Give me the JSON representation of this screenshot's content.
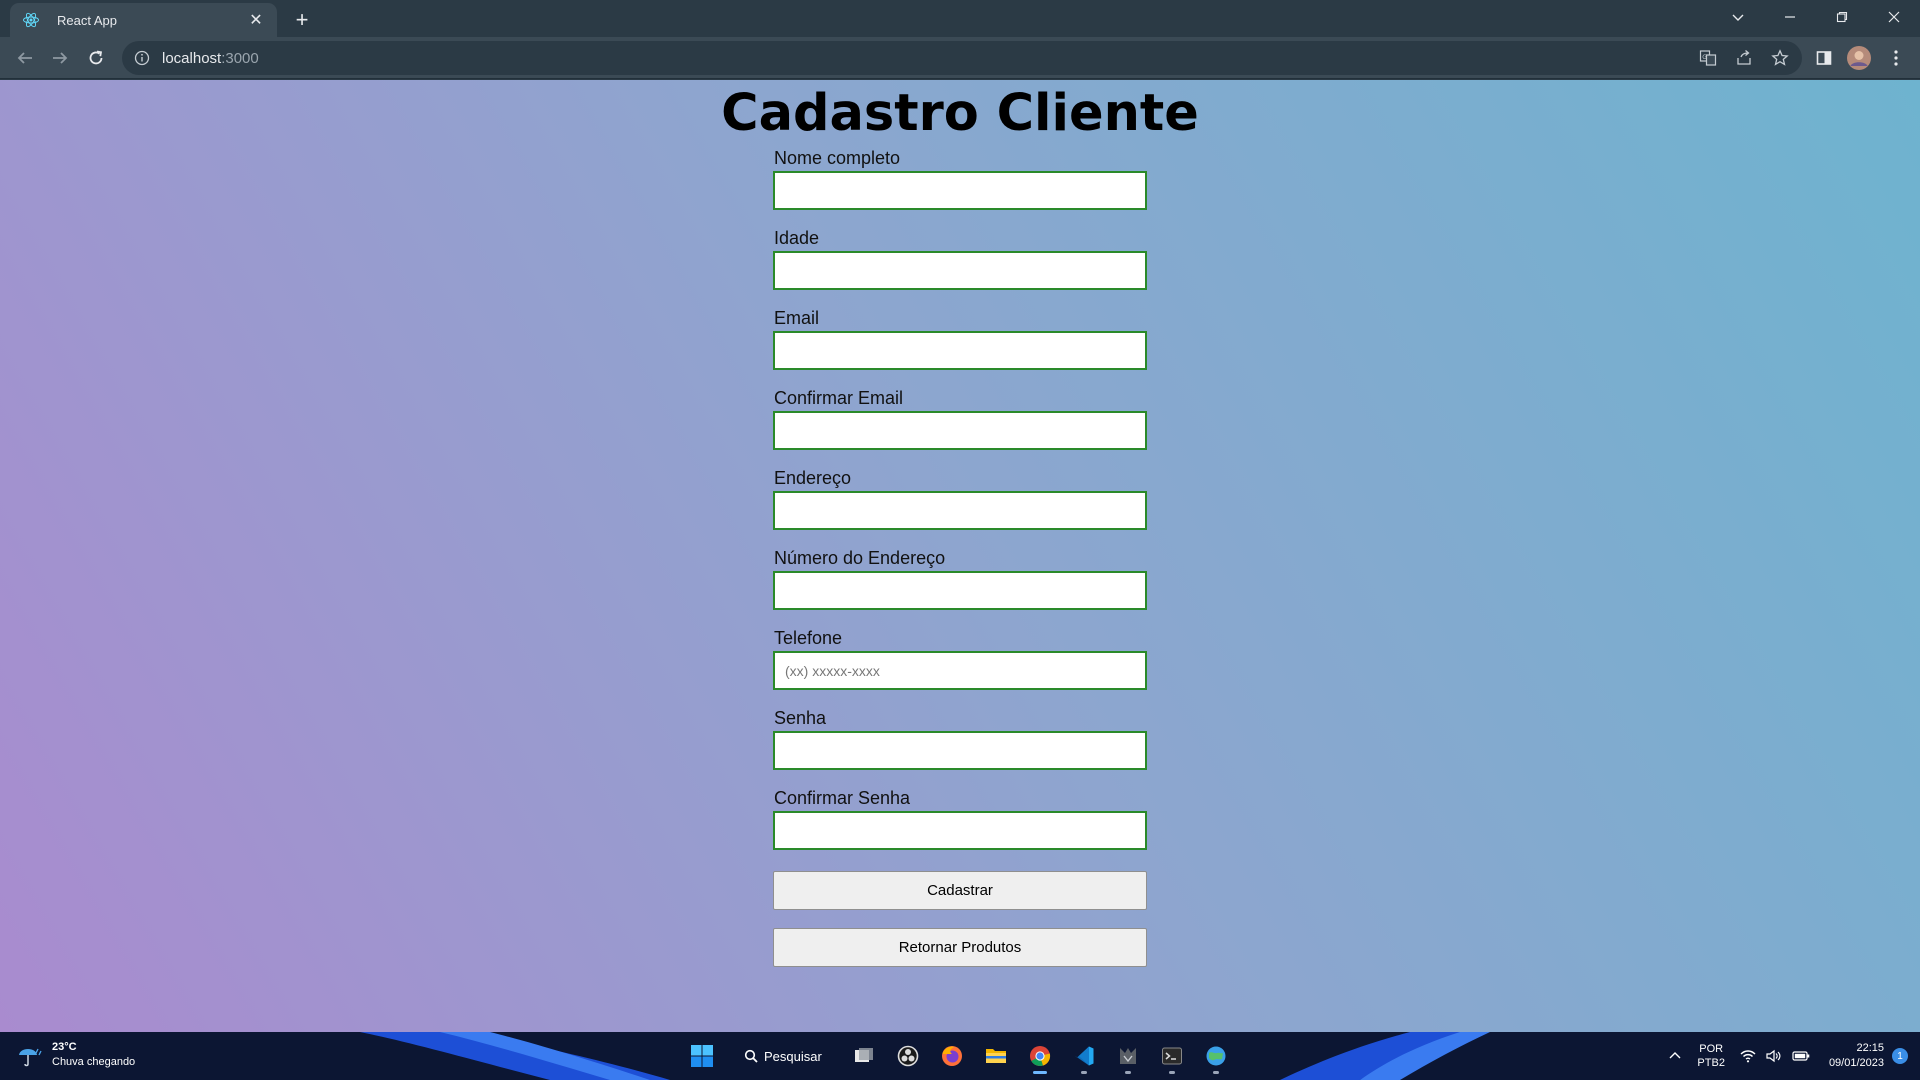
{
  "browser": {
    "tab_title": "React App",
    "url_host": "localhost",
    "url_port": ":3000"
  },
  "page": {
    "title": "Cadastro Cliente",
    "fields": [
      {
        "label": "Nome completo",
        "placeholder": "",
        "value": ""
      },
      {
        "label": "Idade",
        "placeholder": "",
        "value": ""
      },
      {
        "label": "Email",
        "placeholder": "",
        "value": ""
      },
      {
        "label": "Confirmar Email",
        "placeholder": "",
        "value": ""
      },
      {
        "label": "Endereço",
        "placeholder": "",
        "value": ""
      },
      {
        "label": "Número do Endereço",
        "placeholder": "",
        "value": ""
      },
      {
        "label": "Telefone",
        "placeholder": "(xx) xxxxx-xxxx",
        "value": ""
      },
      {
        "label": "Senha",
        "placeholder": "",
        "value": ""
      },
      {
        "label": "Confirmar Senha",
        "placeholder": "",
        "value": ""
      }
    ],
    "submit_label": "Cadastrar",
    "return_label": "Retornar Produtos",
    "input_border_color": "#2a8a2a"
  },
  "taskbar": {
    "weather_temp": "23°C",
    "weather_desc": "Chuva chegando",
    "search_label": "Pesquisar",
    "lang_line1": "POR",
    "lang_line2": "PTB2",
    "time": "22:15",
    "date": "09/01/2023",
    "notification_count": "1"
  }
}
